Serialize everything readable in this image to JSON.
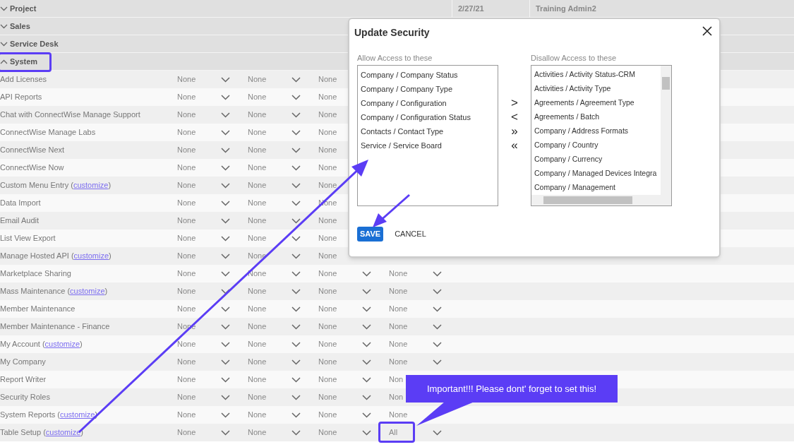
{
  "groups": [
    {
      "label": "Project",
      "expanded": false,
      "cells": [
        "2/27/21",
        "Training Admin2"
      ]
    },
    {
      "label": "Sales",
      "expanded": false
    },
    {
      "label": "Service Desk",
      "expanded": false
    },
    {
      "label": "System",
      "expanded": true,
      "rows": [
        {
          "name": "Add Licenses",
          "cells": [
            {
              "value": "None",
              "dropdown": true
            },
            {
              "value": "None",
              "dropdown": true
            },
            {
              "value": "None",
              "dropdown": false
            }
          ]
        },
        {
          "name": "API Reports",
          "cells": [
            {
              "value": "None",
              "dropdown": true
            },
            {
              "value": "None",
              "dropdown": true
            },
            {
              "value": "None",
              "dropdown": false
            }
          ]
        },
        {
          "name": "Chat with ConnectWise Manage Support",
          "cells": [
            {
              "value": "None",
              "dropdown": true
            },
            {
              "value": "None",
              "dropdown": true
            },
            {
              "value": "None",
              "dropdown": false
            }
          ]
        },
        {
          "name": "ConnectWise Manage Labs",
          "cells": [
            {
              "value": "None",
              "dropdown": true
            },
            {
              "value": "None",
              "dropdown": true
            },
            {
              "value": "None",
              "dropdown": false
            }
          ]
        },
        {
          "name": "ConnectWise Next",
          "cells": [
            {
              "value": "None",
              "dropdown": true
            },
            {
              "value": "None",
              "dropdown": true
            },
            {
              "value": "None",
              "dropdown": false
            }
          ]
        },
        {
          "name": "ConnectWise Now",
          "cells": [
            {
              "value": "None",
              "dropdown": true
            },
            {
              "value": "None",
              "dropdown": true
            },
            {
              "value": "None",
              "dropdown": false
            }
          ]
        },
        {
          "name": "Custom Menu Entry (",
          "link": "customize",
          "suffix": ")",
          "cells": [
            {
              "value": "None",
              "dropdown": true
            },
            {
              "value": "None",
              "dropdown": true
            },
            {
              "value": "None",
              "dropdown": false
            }
          ]
        },
        {
          "name": "Data Import",
          "cells": [
            {
              "value": "None",
              "dropdown": true
            },
            {
              "value": "None",
              "dropdown": true
            },
            {
              "value": "None",
              "dropdown": false
            }
          ]
        },
        {
          "name": "Email Audit",
          "cells": [
            {
              "value": "None",
              "dropdown": true
            },
            {
              "value": "None",
              "dropdown": true
            },
            {
              "value": "None",
              "dropdown": false
            }
          ]
        },
        {
          "name": "List View Export",
          "cells": [
            {
              "value": "None",
              "dropdown": true
            },
            {
              "value": "None",
              "dropdown": true
            },
            {
              "value": "None",
              "dropdown": false
            }
          ]
        },
        {
          "name": "Manage Hosted API (",
          "link": "customize",
          "suffix": ")",
          "cells": [
            {
              "value": "None",
              "dropdown": true
            },
            {
              "value": "None",
              "dropdown": true
            },
            {
              "value": "None",
              "dropdown": false
            }
          ]
        },
        {
          "name": "Marketplace Sharing",
          "cells": [
            {
              "value": "None",
              "dropdown": true
            },
            {
              "value": "None",
              "dropdown": true
            },
            {
              "value": "None",
              "dropdown": true
            },
            {
              "value": "None",
              "dropdown": true
            }
          ]
        },
        {
          "name": "Mass Maintenance (",
          "link": "customize",
          "suffix": ")",
          "cells": [
            {
              "value": "None",
              "dropdown": true
            },
            {
              "value": "None",
              "dropdown": true
            },
            {
              "value": "None",
              "dropdown": true
            },
            {
              "value": "None",
              "dropdown": true
            }
          ]
        },
        {
          "name": "Member Maintenance",
          "cells": [
            {
              "value": "None",
              "dropdown": true
            },
            {
              "value": "None",
              "dropdown": true
            },
            {
              "value": "None",
              "dropdown": true
            },
            {
              "value": "None",
              "dropdown": true
            }
          ]
        },
        {
          "name": "Member Maintenance - Finance",
          "cells": [
            {
              "value": "None",
              "dropdown": true
            },
            {
              "value": "None",
              "dropdown": true
            },
            {
              "value": "None",
              "dropdown": true
            },
            {
              "value": "None",
              "dropdown": true
            }
          ]
        },
        {
          "name": "My Account (",
          "link": "customize",
          "suffix": ")",
          "cells": [
            {
              "value": "None",
              "dropdown": true
            },
            {
              "value": "None",
              "dropdown": true
            },
            {
              "value": "None",
              "dropdown": true
            },
            {
              "value": "None",
              "dropdown": true
            }
          ]
        },
        {
          "name": "My Company",
          "cells": [
            {
              "value": "None",
              "dropdown": true
            },
            {
              "value": "None",
              "dropdown": true
            },
            {
              "value": "None",
              "dropdown": true
            },
            {
              "value": "None",
              "dropdown": true
            }
          ]
        },
        {
          "name": "Report Writer",
          "cells": [
            {
              "value": "None",
              "dropdown": true
            },
            {
              "value": "None",
              "dropdown": true
            },
            {
              "value": "None",
              "dropdown": true
            },
            {
              "value": "Non",
              "dropdown": false
            }
          ]
        },
        {
          "name": "Security Roles",
          "cells": [
            {
              "value": "None",
              "dropdown": true
            },
            {
              "value": "None",
              "dropdown": true
            },
            {
              "value": "None",
              "dropdown": true
            },
            {
              "value": "Non",
              "dropdown": false
            }
          ]
        },
        {
          "name": "System Reports (",
          "link": "customize",
          "suffix": ")",
          "cells": [
            {
              "value": "None",
              "dropdown": true
            },
            {
              "value": "None",
              "dropdown": true
            },
            {
              "value": "None",
              "dropdown": true
            },
            {
              "value": "None",
              "dropdown": false
            }
          ]
        },
        {
          "name": "Table Setup (",
          "link": "customize",
          "suffix": ")",
          "cells": [
            {
              "value": "None",
              "dropdown": true
            },
            {
              "value": "None",
              "dropdown": true
            },
            {
              "value": "None",
              "dropdown": true
            },
            {
              "value": "All",
              "dropdown": true
            }
          ]
        }
      ]
    }
  ],
  "modal": {
    "title": "Update Security",
    "allow_label": "Allow Access to these",
    "allow_items": [
      "Company / Company Status",
      "Company / Company Type",
      "Company / Configuration",
      "Company / Configuration Status",
      "Contacts / Contact Type",
      "Service / Service Board"
    ],
    "disallow_label": "Disallow Access to these",
    "disallow_items": [
      "Activities / Activity Status-CRM",
      "Activities / Activity Type",
      "Agreements / Agreement Type",
      "Agreements / Batch",
      "Company / Address Formats",
      "Company / Country",
      "Company / Currency",
      "Company / Managed Devices Integra",
      "Company / Management"
    ],
    "move_buttons": [
      ">",
      "<",
      "»",
      "«"
    ],
    "save": "SAVE",
    "cancel": "CANCEL"
  },
  "callout": "Important!!! Please dont' forget to set this!"
}
